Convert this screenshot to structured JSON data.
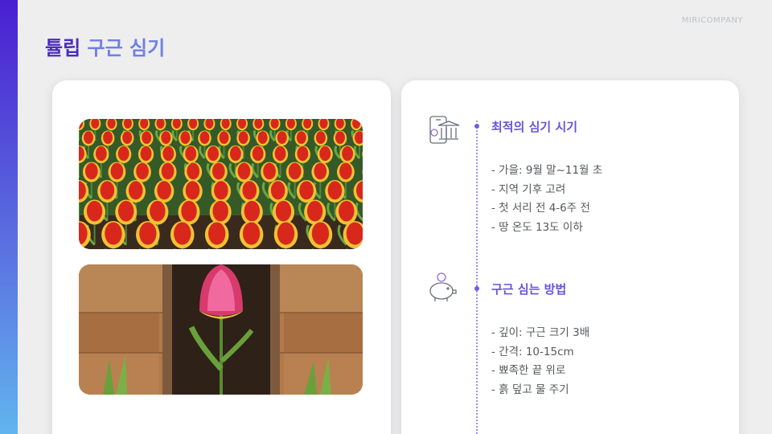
{
  "brand": "MIRICOMPANY",
  "title": {
    "part1": "튤립",
    "part2": "구근 심기"
  },
  "sections": [
    {
      "title": "최적의 심기 시기",
      "icon": "mobile-bank-icon",
      "items": [
        "- 가을: 9월 말~11월 초",
        "- 지역 기후 고려",
        "- 첫 서리 전 4-6주 전",
        "- 땅 온도 13도 이하"
      ]
    },
    {
      "title": "구근 심는 방법",
      "icon": "piggy-bank-icon",
      "items": [
        "- 깊이: 구근 크기 3배",
        "- 간격: 10-15cm",
        "- 뾰족한 끝 위로",
        "- 흙 덮고 물 주기"
      ]
    }
  ],
  "images": [
    "tulip-field-photo",
    "tulip-in-soil-photo"
  ],
  "colors": {
    "title_dark": "#4b2bbf",
    "title_light": "#6f7fe6",
    "accent": "#6556d8"
  }
}
